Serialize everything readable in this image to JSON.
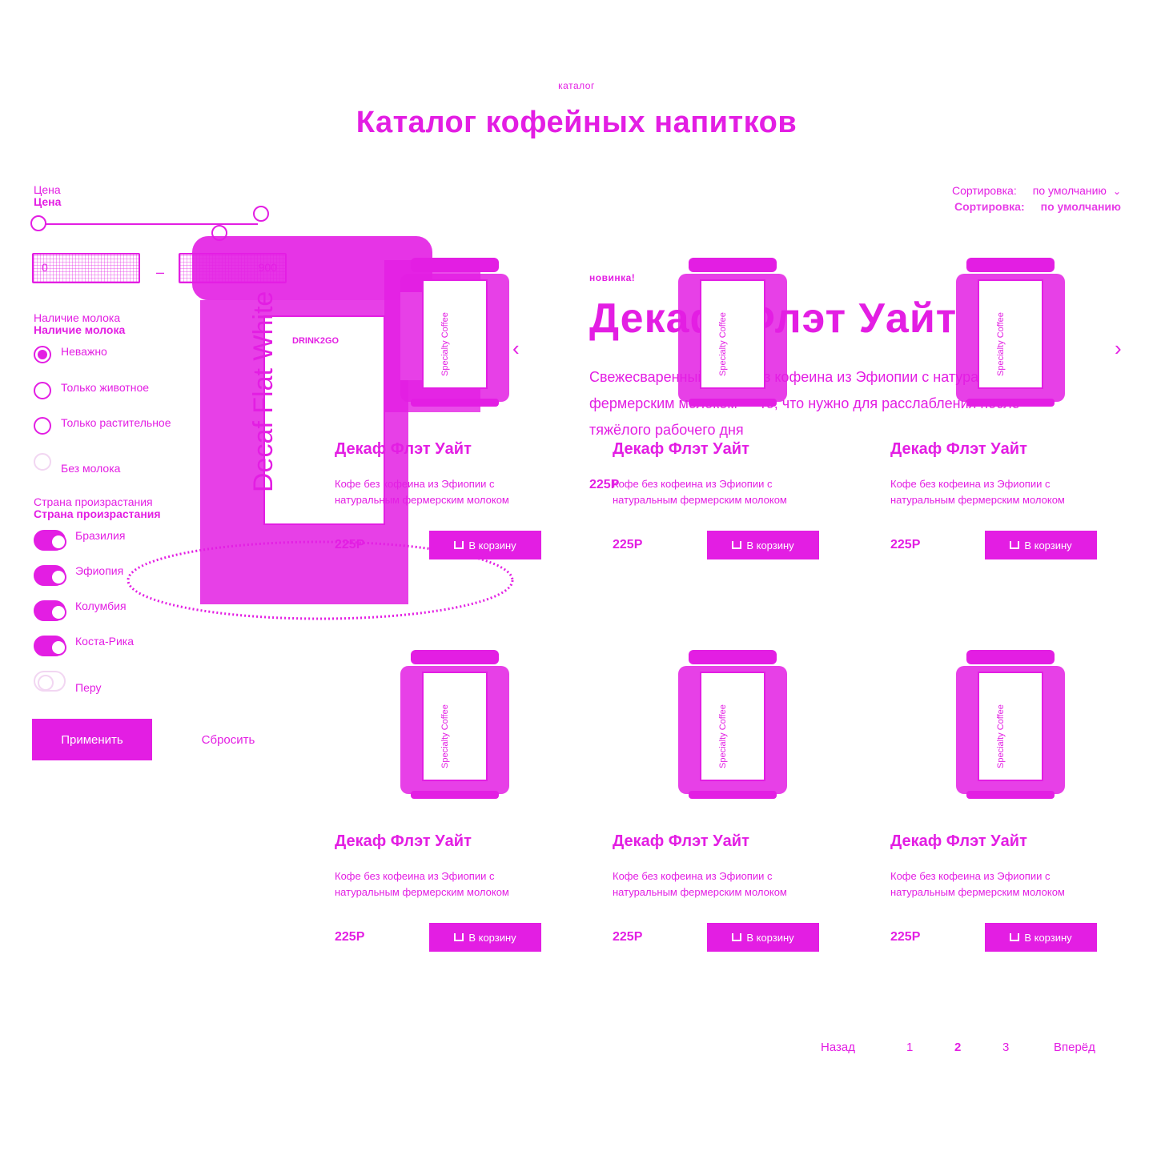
{
  "breadcrumb": "каталог",
  "title": "Каталог кофейных напитков",
  "sort": {
    "label": "Сортировка:",
    "value": "по умолчанию"
  },
  "filters": {
    "price": {
      "label": "Цена",
      "min_value": "0",
      "max_value": "900",
      "dash": "–"
    },
    "milk": {
      "label": "Наличие молока",
      "options": [
        {
          "label": "Неважно",
          "selected": true
        },
        {
          "label": "Только животное",
          "selected": false
        },
        {
          "label": "Только растительное",
          "selected": false
        },
        {
          "label": "Без молока",
          "selected": false
        }
      ]
    },
    "country": {
      "label": "Страна произрастания",
      "options": [
        {
          "label": "Бразилия",
          "checked": true
        },
        {
          "label": "Эфиопия",
          "checked": true
        },
        {
          "label": "Колумбия",
          "checked": true
        },
        {
          "label": "Коста-Рика",
          "checked": true
        },
        {
          "label": "Перу",
          "checked": false
        }
      ]
    },
    "apply_label": "Применить",
    "reset_label": "Сбросить"
  },
  "banner": {
    "badge": "новинка!",
    "title": "Декаф Флэт Уайт",
    "description": "Свежесваренный кофе без кофеина из Эфиопии с натуральным фермерским молоком — то, что нужно для расслабления после тяжёлого рабочего дня",
    "price": "225Р",
    "brand": "DRINK2GO",
    "can_text": "Decaf Flat White"
  },
  "products": [
    {
      "name": "Декаф Флэт Уайт",
      "desc": "Кофе без кофеина из Эфиопии с натуральным фермерским молоком",
      "price": "225Р",
      "cart_label": "В корзину"
    },
    {
      "name": "Декаф Флэт Уайт",
      "desc": "Кофе без кофеина из Эфиопии с натуральным фермерским молоком",
      "price": "225Р",
      "cart_label": "В корзину"
    },
    {
      "name": "Декаф Флэт Уайт",
      "desc": "Кофе без кофеина из Эфиопии с натуральным фермерским молоком",
      "price": "225Р",
      "cart_label": "В корзину"
    },
    {
      "name": "Декаф Флэт Уайт",
      "desc": "Кофе без кофеина из Эфиопии с натуральным фермерским молоком",
      "price": "225Р",
      "cart_label": "В корзину"
    },
    {
      "name": "Декаф Флэт Уайт",
      "desc": "Кофе без кофеина из Эфиопии с натуральным фермерским молоком",
      "price": "225Р",
      "cart_label": "В корзину"
    },
    {
      "name": "Декаф Флэт Уайт",
      "desc": "Кофе без кофеина из Эфиопии с натуральным фермерским молоком",
      "price": "225Р",
      "cart_label": "В корзину"
    }
  ],
  "can_label": "Specialty Coffee",
  "pagination": {
    "prev": "Назад",
    "pages": [
      "1",
      "2",
      "3"
    ],
    "current": "2",
    "next": "Вперёд"
  },
  "colors": {
    "accent": "#e31ee3",
    "background": "#ffffff"
  }
}
